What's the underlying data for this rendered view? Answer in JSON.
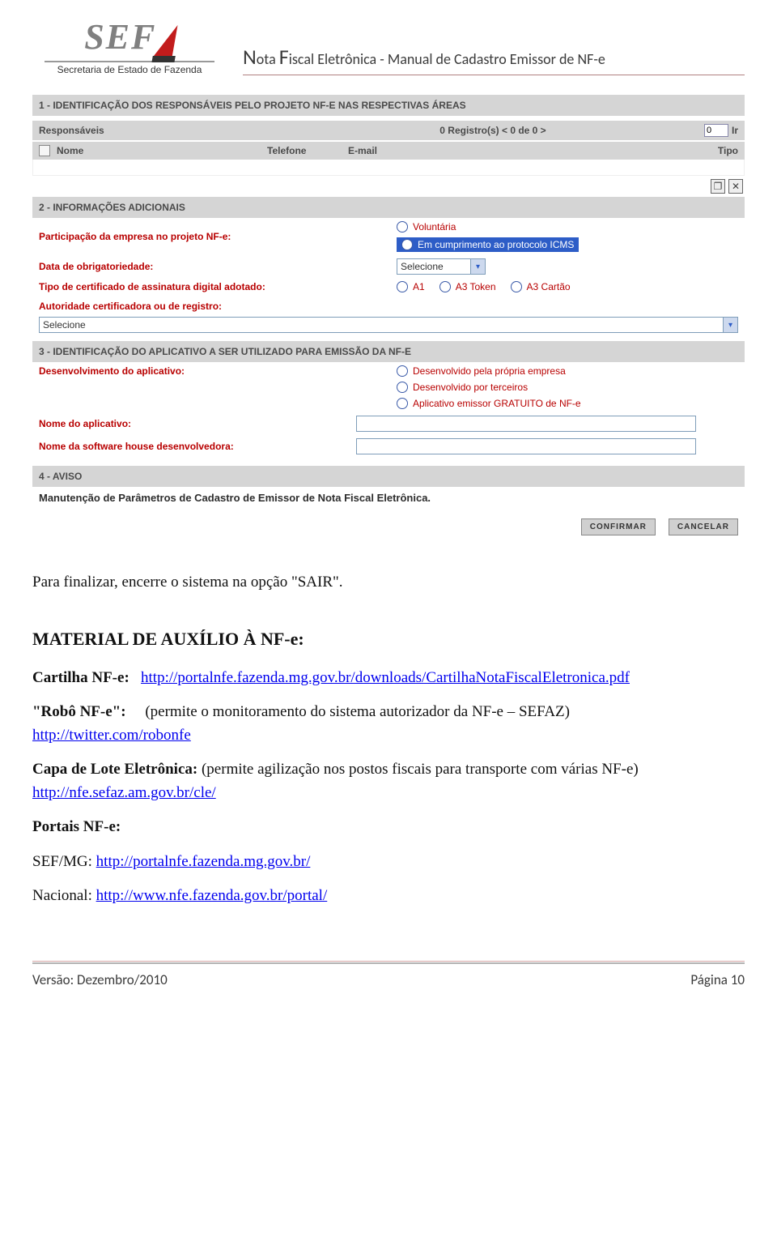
{
  "header": {
    "logo_text": "SEF",
    "logo_subtitle": "Secretaria de Estado de Fazenda",
    "doc_title": "Nota Fiscal Eletrônica - Manual de Cadastro Emissor de NF-e"
  },
  "form": {
    "section1": {
      "title": "1 - IDENTIFICAÇÃO DOS RESPONSÁVEIS PELO PROJETO NF-E NAS RESPECTIVAS ÁREAS",
      "resp_label": "Responsáveis",
      "regs_text": "0  Registro(s) <  0 de 0  >",
      "page_input": "0",
      "ir_label": "Ir",
      "cols": {
        "nome": "Nome",
        "tel": "Telefone",
        "mail": "E-mail",
        "tipo": "Tipo"
      },
      "icon_copy": "❐",
      "icon_del": "✕"
    },
    "section2": {
      "title": "2 - INFORMAÇÕES ADICIONAIS",
      "participacao_label": "Participação da empresa no projeto NF-e:",
      "participacao_opts": [
        "Voluntária",
        "Em cumprimento ao protocolo ICMS"
      ],
      "data_obrig_label": "Data de obrigatoriedade:",
      "selecione": "Selecione",
      "tipo_cert_label": "Tipo de certificado de assinatura digital adotado:",
      "cert_opts": [
        "A1",
        "A3 Token",
        "A3 Cartão"
      ],
      "autoridade_label": "Autoridade certificadora ou de registro:"
    },
    "section3": {
      "title": "3 - IDENTIFICAÇÃO DO APLICATIVO A SER UTILIZADO PARA EMISSÃO DA NF-E",
      "dev_label": "Desenvolvimento do aplicativo:",
      "dev_opts": [
        "Desenvolvido pela própria empresa",
        "Desenvolvido por terceiros",
        "Aplicativo emissor GRATUITO de NF-e"
      ],
      "nome_app_label": "Nome do aplicativo:",
      "nome_sh_label": "Nome da software house desenvolvedora:"
    },
    "section4": {
      "title": "4 - AVISO",
      "text": "Manutenção de Parâmetros de Cadastro de Emissor de Nota Fiscal Eletrônica."
    },
    "buttons": {
      "confirmar": "CONFIRMAR",
      "cancelar": "CANCELAR"
    }
  },
  "body": {
    "finalizar": "Para finalizar, encerre o sistema na opção \"SAIR\".",
    "aux_title": "MATERIAL DE AUXÍLIO À NF-e:",
    "cartilha_label": "Cartilha NF-e:",
    "cartilha_url": "http://portalnfe.fazenda.mg.gov.br/downloads/CartilhaNotaFiscalEletronica.pdf",
    "robo_label": "\"Robô NF-e\":",
    "robo_text": "(permite o monitoramento do sistema autorizador da NF-e – SEFAZ)",
    "robo_url": "http://twitter.com/robonfe",
    "capa_label": "Capa de Lote Eletrônica:",
    "capa_text": "(permite agilização nos postos fiscais para transporte com várias NF-e)",
    "capa_url": "http://nfe.sefaz.am.gov.br/cle/",
    "portais_label": "Portais NF-e:",
    "sefmg_label": "SEF/MG:",
    "sefmg_url": "http://portalnfe.fazenda.mg.gov.br/",
    "nacional_label": "Nacional:",
    "nacional_url": "http://www.nfe.fazenda.gov.br/portal/"
  },
  "footer": {
    "versao": "Versão: Dezembro/2010",
    "pagina": "Página 10"
  }
}
